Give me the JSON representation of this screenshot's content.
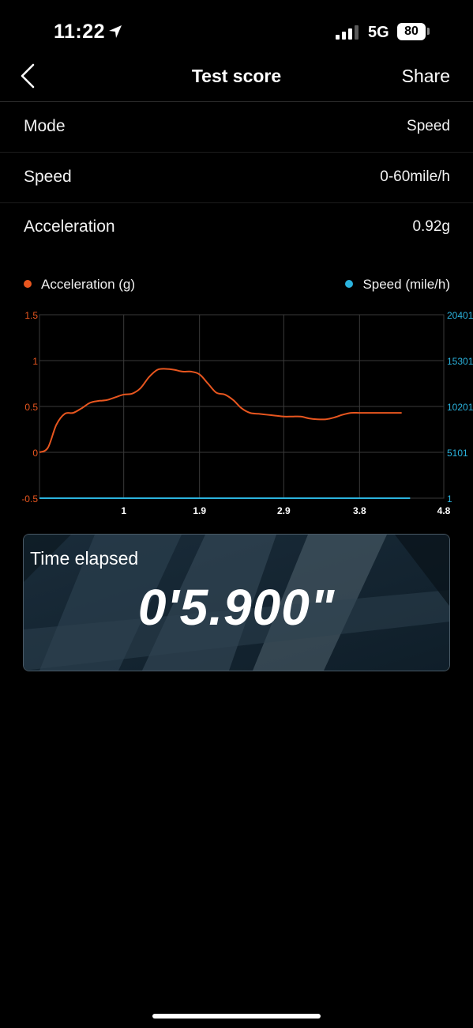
{
  "status_bar": {
    "time": "11:22",
    "network": "5G",
    "battery": "80"
  },
  "nav": {
    "title": "Test score",
    "share_label": "Share"
  },
  "info_rows": [
    {
      "label": "Mode",
      "value": "Speed"
    },
    {
      "label": "Speed",
      "value": "0-60mile/h"
    },
    {
      "label": "Acceleration",
      "value": "0.92g"
    }
  ],
  "time_card": {
    "label": "Time elapsed",
    "value": "0'5.900\""
  },
  "colors": {
    "acceleration": "#e8561f",
    "speed": "#2bb3de",
    "grid": "#3a3a3a"
  },
  "chart_data": {
    "type": "line",
    "x_ticks": [
      "1",
      "1.9",
      "2.9",
      "3.8",
      "4.8"
    ],
    "x_tick_values": [
      1,
      1.9,
      2.9,
      3.8,
      4.8
    ],
    "xlim": [
      0,
      4.8
    ],
    "y_left_ticks": [
      "1.5",
      "1",
      "0.5",
      "0",
      "-0.5"
    ],
    "y_left_lim": [
      -0.5,
      1.5
    ],
    "y_right_ticks": [
      "20401",
      "15301",
      "10201",
      "5101",
      "1"
    ],
    "y_right_lim": [
      1,
      20401
    ],
    "grid": true,
    "series": [
      {
        "name": "Acceleration (g)",
        "axis": "left",
        "color": "#e8561f",
        "x": [
          0,
          0.1,
          0.2,
          0.3,
          0.4,
          0.5,
          0.6,
          0.7,
          0.8,
          0.9,
          1.0,
          1.1,
          1.2,
          1.3,
          1.4,
          1.5,
          1.6,
          1.7,
          1.8,
          1.9,
          2.0,
          2.1,
          2.2,
          2.3,
          2.4,
          2.5,
          2.6,
          2.7,
          2.8,
          2.9,
          3.0,
          3.1,
          3.2,
          3.3,
          3.4,
          3.5,
          3.6,
          3.7,
          3.8,
          3.9,
          4.0,
          4.1,
          4.2,
          4.3
        ],
        "values": [
          0.0,
          0.05,
          0.3,
          0.42,
          0.43,
          0.48,
          0.54,
          0.56,
          0.57,
          0.6,
          0.63,
          0.64,
          0.7,
          0.82,
          0.9,
          0.91,
          0.9,
          0.88,
          0.88,
          0.85,
          0.75,
          0.65,
          0.63,
          0.57,
          0.48,
          0.43,
          0.42,
          0.41,
          0.4,
          0.39,
          0.39,
          0.39,
          0.37,
          0.36,
          0.36,
          0.38,
          0.41,
          0.43,
          0.43,
          0.43,
          0.43,
          0.43,
          0.43,
          0.43
        ]
      },
      {
        "name": "Speed (mile/h)",
        "axis": "right",
        "color": "#2bb3de",
        "x": [
          0,
          4.4
        ],
        "values": [
          1,
          1
        ]
      }
    ]
  }
}
